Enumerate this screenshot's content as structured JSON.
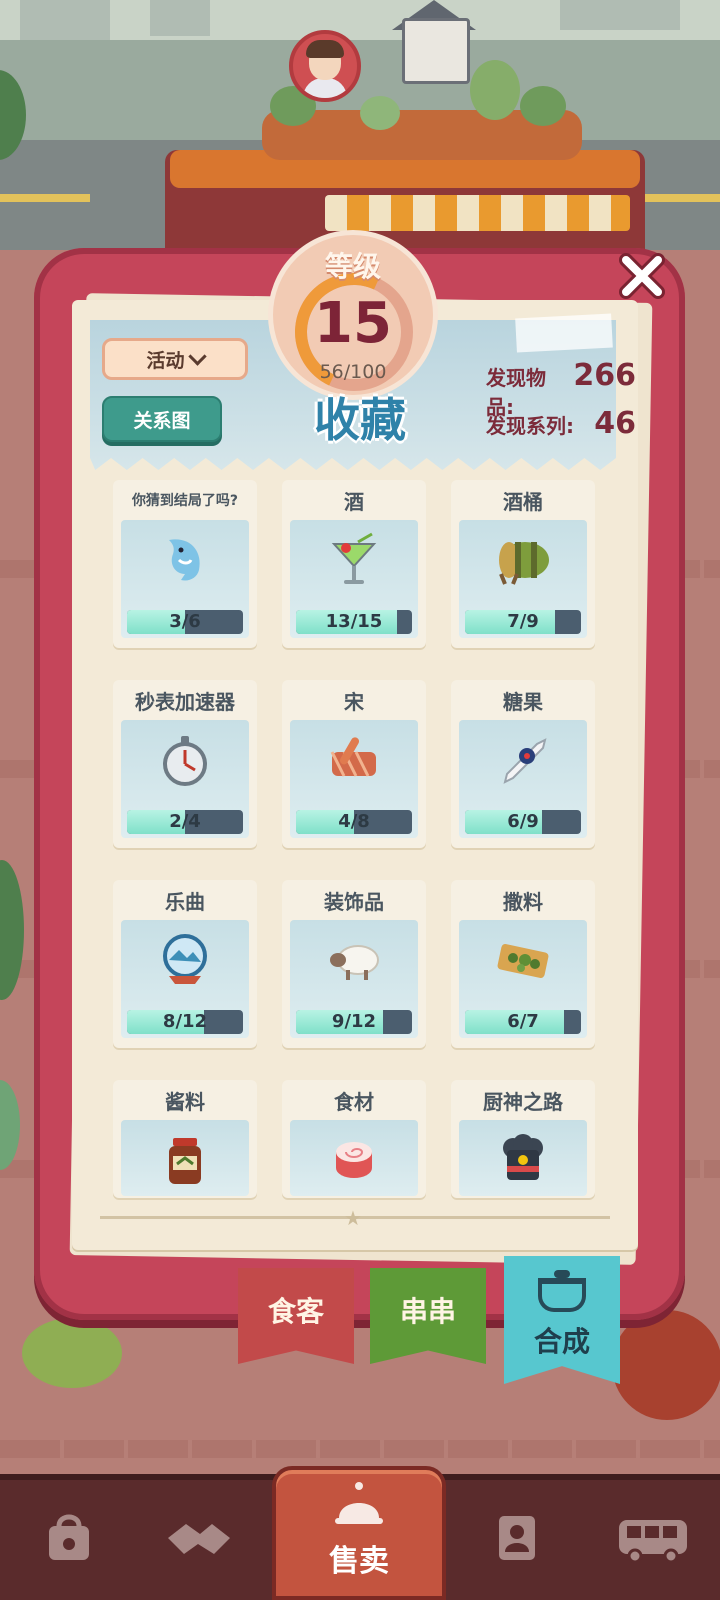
{
  "level": {
    "title": "等级",
    "value": "15",
    "progress": "56/100",
    "fraction": 0.56
  },
  "page_title": "收藏",
  "filter": {
    "label": "活动"
  },
  "relation_button": "关系图",
  "stats": [
    {
      "label": "发现物品:",
      "value": "266"
    },
    {
      "label": "发现系列:",
      "value": "46"
    }
  ],
  "collections": [
    {
      "title": "你猜到结局了吗?",
      "progress": "3/6",
      "fraction": 0.5,
      "icon": "dolphin-icon"
    },
    {
      "title": "酒",
      "progress": "13/15",
      "fraction": 0.867,
      "icon": "cocktail-icon"
    },
    {
      "title": "酒桶",
      "progress": "7/9",
      "fraction": 0.778,
      "icon": "barrel-icon"
    },
    {
      "title": "秒表加速器",
      "progress": "2/4",
      "fraction": 0.5,
      "icon": "stopwatch-icon"
    },
    {
      "title": "宋",
      "progress": "4/8",
      "fraction": 0.5,
      "icon": "scroll-icon"
    },
    {
      "title": "糖果",
      "progress": "6/9",
      "fraction": 0.667,
      "icon": "candy-icon"
    },
    {
      "title": "乐曲",
      "progress": "8/12",
      "fraction": 0.667,
      "icon": "snow-globe-icon"
    },
    {
      "title": "装饰品",
      "progress": "9/12",
      "fraction": 0.75,
      "icon": "sheep-icon"
    },
    {
      "title": "撒料",
      "progress": "6/7",
      "fraction": 0.857,
      "icon": "seasoning-tray-icon"
    },
    {
      "title": "酱料",
      "progress": "",
      "fraction": null,
      "icon": "sauce-jar-icon"
    },
    {
      "title": "食材",
      "progress": "",
      "fraction": null,
      "icon": "fish-cake-icon"
    },
    {
      "title": "厨神之路",
      "progress": "",
      "fraction": null,
      "icon": "chef-hat-icon"
    }
  ],
  "category_tabs": [
    {
      "label": "食客",
      "color": "#c24a4a"
    },
    {
      "label": "串串",
      "color": "#5e9a37"
    },
    {
      "label": "合成",
      "color": "#57c7cf"
    }
  ],
  "bottom_nav": [
    {
      "label": "",
      "icon": "bag-icon"
    },
    {
      "label": "",
      "icon": "handshake-icon"
    },
    {
      "label": "售卖",
      "icon": "service-bell-icon"
    },
    {
      "label": "",
      "icon": "profile-card-icon"
    },
    {
      "label": "",
      "icon": "bus-icon"
    }
  ],
  "colors": {
    "frame": "#c5455a",
    "accent_title": "#2f82a9",
    "bar_fill": "#7fe0c9",
    "bar_track": "#4b5e6f"
  }
}
